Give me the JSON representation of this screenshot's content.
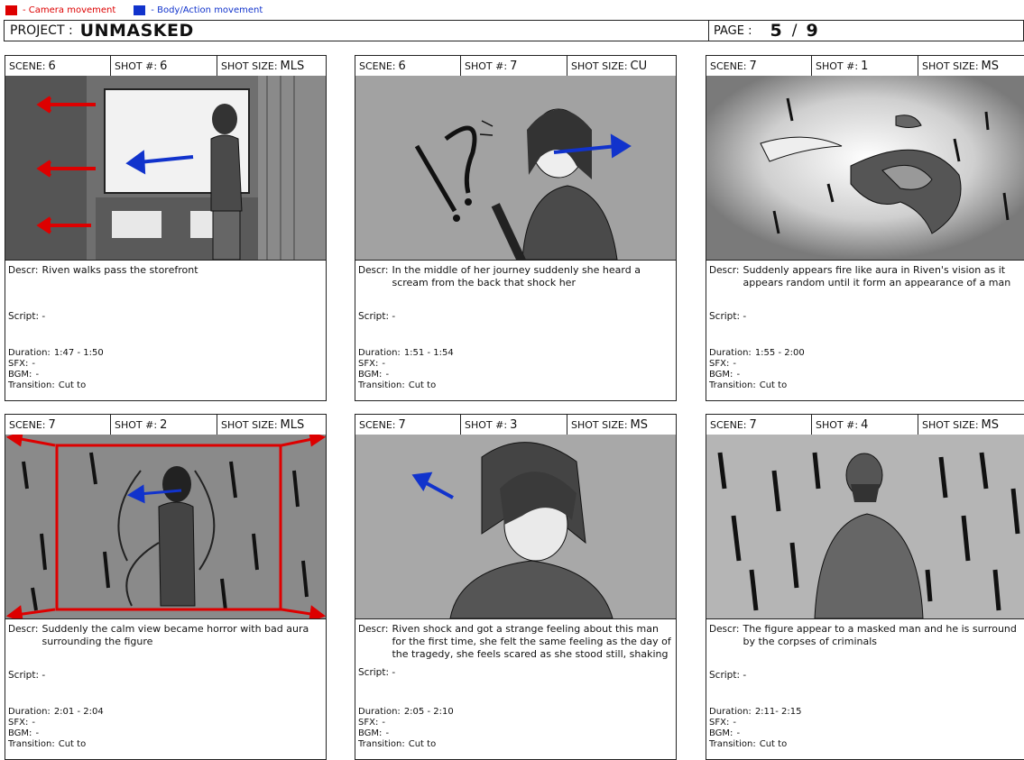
{
  "legend": {
    "camera": {
      "label": "- Camera movement",
      "color": "#dd0000"
    },
    "body": {
      "label": "- Body/Action movement",
      "color": "#1133cc"
    }
  },
  "header": {
    "project_label": "PROJECT :",
    "project_name": "UNMASKED",
    "page_label": "PAGE :",
    "page_current": "5",
    "page_sep": "/",
    "page_total": "9"
  },
  "labels": {
    "scene": "SCENE:",
    "shot": "SHOT #:",
    "size": "SHOT SIZE:",
    "descr": "Descr:",
    "script": "Script:",
    "duration": "Duration:",
    "sfx": "SFX:",
    "bgm": "BGM:",
    "transition": "Transition:"
  },
  "panels": [
    {
      "scene": "6",
      "shot": "6",
      "size": "MLS",
      "image": "man-walking-past-storefront-drawing",
      "descr": "Riven walks pass the storefront",
      "script": "-",
      "duration": "1:47 - 1:50",
      "sfx": "-",
      "bgm": "-",
      "transition": "Cut to"
    },
    {
      "scene": "6",
      "shot": "7",
      "size": "CU",
      "image": "girl-startled-closeup-drawing",
      "descr": "In the middle of her journey suddenly she heard a scream from the back that shock her",
      "script": "-",
      "duration": "1:51 - 1:54",
      "sfx": "-",
      "bgm": "-",
      "transition": "Cut to"
    },
    {
      "scene": "7",
      "shot": "1",
      "size": "MS",
      "image": "fire-aura-swirl-drawing",
      "descr": "Suddenly appears fire like aura in Riven's vision as it appears random until it form an appearance of a man",
      "script": "-",
      "duration": "1:55 - 2:00",
      "sfx": "-",
      "bgm": "-",
      "transition": "Cut to"
    },
    {
      "scene": "7",
      "shot": "2",
      "size": "MLS",
      "image": "masked-figure-dark-aura-drawing",
      "descr": "Suddenly the calm view became horror with bad aura surrounding the figure",
      "script": "-",
      "duration": "2:01 - 2:04",
      "sfx": "-",
      "bgm": "-",
      "transition": "Cut to"
    },
    {
      "scene": "7",
      "shot": "3",
      "size": "MS",
      "image": "girl-scared-looking-down-drawing",
      "descr": "Riven shock and got a strange feeling about this man for the first time, she felt the same feeling as the day of the tragedy, she feels scared as she stood still, shaking",
      "script": "-",
      "duration": "2:05 - 2:10",
      "sfx": "-",
      "bgm": "-",
      "transition": "Cut to"
    },
    {
      "scene": "7",
      "shot": "4",
      "size": "MS",
      "image": "masked-man-among-corpses-drawing",
      "descr": "The figure appear to a masked man and he is surround by the corpses of criminals",
      "script": "-",
      "duration": "2:11- 2:15",
      "sfx": "-",
      "bgm": "-",
      "transition": "Cut to"
    }
  ]
}
